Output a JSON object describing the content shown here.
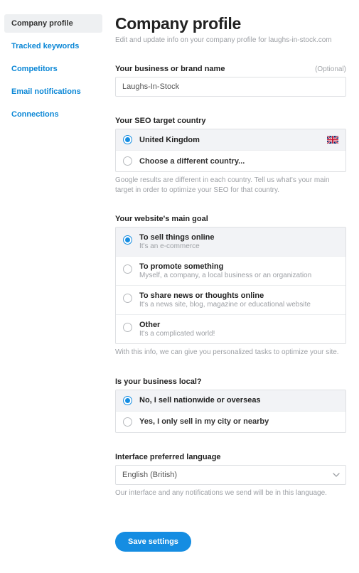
{
  "sidebar": {
    "items": [
      {
        "label": "Company profile",
        "active": true
      },
      {
        "label": "Tracked keywords",
        "active": false
      },
      {
        "label": "Competitors",
        "active": false
      },
      {
        "label": "Email notifications",
        "active": false
      },
      {
        "label": "Connections",
        "active": false
      }
    ]
  },
  "header": {
    "title": "Company profile",
    "subtitle": "Edit and update info on your company profile for laughs-in-stock.com"
  },
  "business_name": {
    "label": "Your business or brand name",
    "optional": "(Optional)",
    "value": "Laughs-In-Stock"
  },
  "seo_country": {
    "label": "Your SEO target country",
    "options": [
      {
        "label": "United Kingdom",
        "selected": true,
        "flag": "gb"
      },
      {
        "label": "Choose a different country...",
        "selected": false
      }
    ],
    "helper": "Google results are different in each country. Tell us what's your main target in order to optimize your SEO for that country."
  },
  "main_goal": {
    "label": "Your website's main goal",
    "options": [
      {
        "title": "To sell things online",
        "sub": "It's an e-commerce",
        "selected": true
      },
      {
        "title": "To promote something",
        "sub": "Myself, a company, a local business or an organization",
        "selected": false
      },
      {
        "title": "To share news or thoughts online",
        "sub": "It's a news site, blog, magazine or educational website",
        "selected": false
      },
      {
        "title": "Other",
        "sub": "It's a complicated world!",
        "selected": false
      }
    ],
    "helper": "With this info, we can give you personalized tasks to optimize your site."
  },
  "local_business": {
    "label": "Is your business local?",
    "options": [
      {
        "label": "No, I sell nationwide or overseas",
        "selected": true
      },
      {
        "label": "Yes, I only sell in my city or nearby",
        "selected": false
      }
    ]
  },
  "language": {
    "label": "Interface preferred language",
    "value": "English (British)",
    "helper": "Our interface and any notifications we send will be in this language."
  },
  "save_button": "Save settings"
}
